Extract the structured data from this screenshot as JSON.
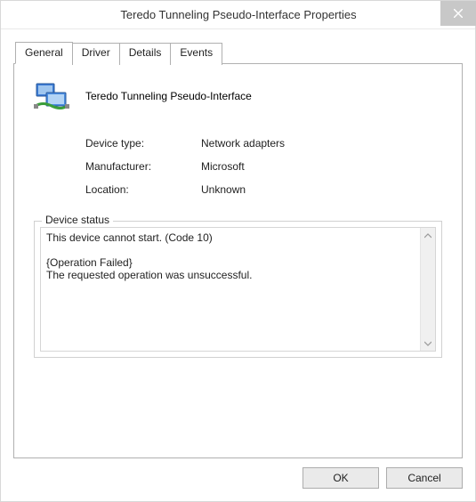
{
  "window": {
    "title": "Teredo Tunneling Pseudo-Interface Properties"
  },
  "tabs": [
    {
      "label": "General"
    },
    {
      "label": "Driver"
    },
    {
      "label": "Details"
    },
    {
      "label": "Events"
    }
  ],
  "device": {
    "name": "Teredo Tunneling Pseudo-Interface",
    "type_label": "Device type:",
    "type_value": "Network adapters",
    "manufacturer_label": "Manufacturer:",
    "manufacturer_value": "Microsoft",
    "location_label": "Location:",
    "location_value": "Unknown"
  },
  "status": {
    "legend": "Device status",
    "text": "This device cannot start. (Code 10)\n\n{Operation Failed}\nThe requested operation was unsuccessful."
  },
  "buttons": {
    "ok": "OK",
    "cancel": "Cancel"
  }
}
